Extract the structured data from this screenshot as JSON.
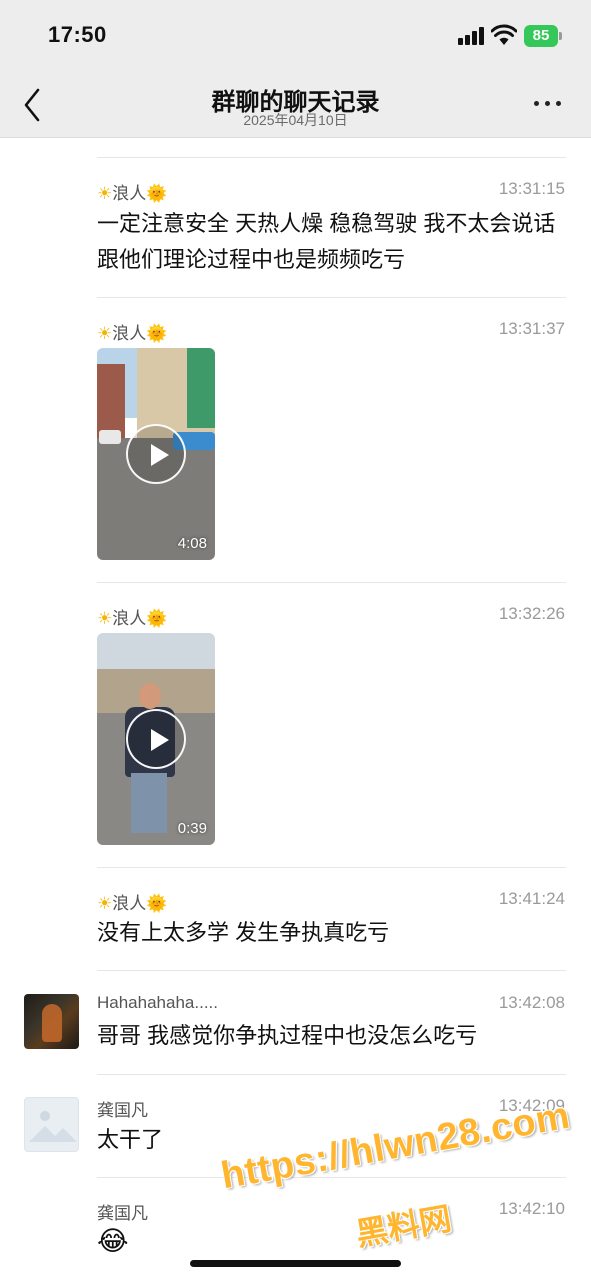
{
  "status_bar": {
    "time": "17:50",
    "battery": "85"
  },
  "header": {
    "title": "群聊的聊天记录",
    "subtitle": "2025年04月10日"
  },
  "messages": [
    {
      "sender": "浪人",
      "time": "13:31:15",
      "text": "一定注意安全 天热人燥 稳稳驾驶 我不太会说话 跟他们理论过程中也是频频吃亏"
    },
    {
      "sender": "浪人",
      "time": "13:31:37",
      "video_duration": "4:08"
    },
    {
      "sender": "浪人",
      "time": "13:32:26",
      "video_duration": "0:39"
    },
    {
      "sender": "浪人",
      "time": "13:41:24",
      "text": "没有上太多学 发生争执真吃亏"
    },
    {
      "sender": "Hahahahaha.....",
      "time": "13:42:08",
      "text": "哥哥 我感觉你争执过程中也没怎么吃亏"
    },
    {
      "sender": "龚国凡",
      "time": "13:42:09",
      "text": "太干了"
    },
    {
      "sender": "龚国凡",
      "time": "13:42:10",
      "emoji": "😂"
    }
  ],
  "emojis": {
    "sun": "☀",
    "sun_face": "🌞"
  },
  "watermark": {
    "url": "https://hlwn28.com",
    "name": "黑料网"
  },
  "colors": {
    "battery": "#35c759",
    "watermark": "#ffb52e"
  }
}
